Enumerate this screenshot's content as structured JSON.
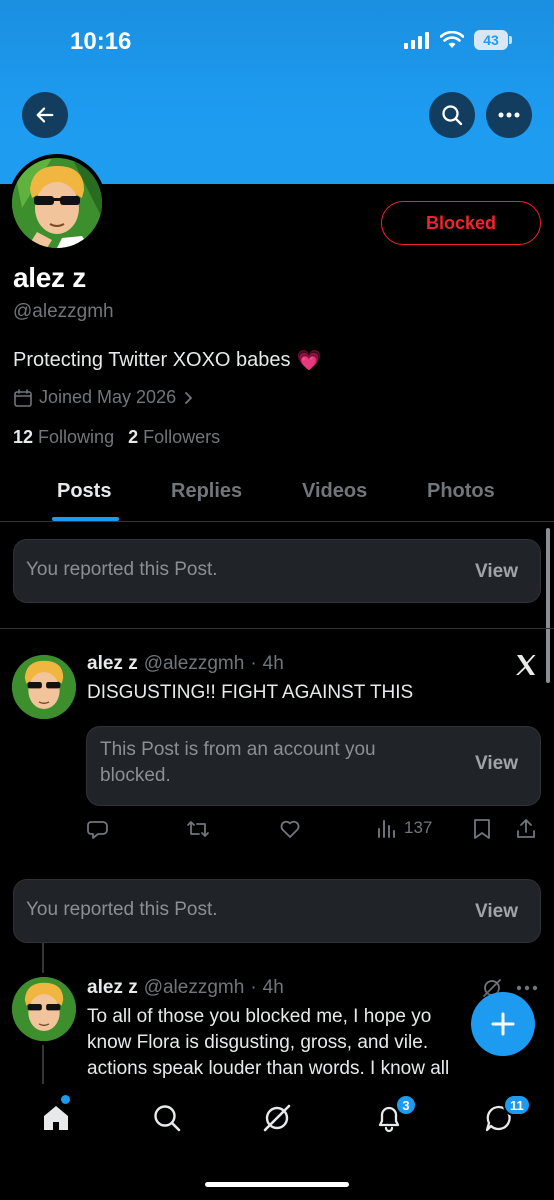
{
  "status_bar": {
    "time": "10:16",
    "battery": "43"
  },
  "header": {
    "back_icon": "arrow-left-icon",
    "search_icon": "search-icon",
    "more_icon": "more-horizontal-icon",
    "banner_color": "#1d9bf0"
  },
  "profile": {
    "name": "alez z",
    "handle": "@alezzgmh",
    "bio": "Protecting Twitter XOXO babes",
    "bio_emoji": "💗",
    "joined": "Joined May 2026",
    "following_count": "12",
    "following_label": "Following",
    "followers_count": "2",
    "followers_label": "Followers",
    "blocked_label": "Blocked",
    "blocked_color": "#f4212e"
  },
  "tabs": [
    {
      "label": "Posts",
      "active": true
    },
    {
      "label": "Replies",
      "active": false
    },
    {
      "label": "Videos",
      "active": false
    },
    {
      "label": "Photos",
      "active": false
    }
  ],
  "feed": {
    "report_notice_1": {
      "text": "You reported this Post.",
      "action": "View"
    },
    "post_1": {
      "name": "alez z",
      "handle": "@alezzgmh",
      "sep": "·",
      "time": "4h",
      "text": "DISGUSTING!! FIGHT AGAINST THIS",
      "quote_text": "This Post is from an account you blocked.",
      "quote_action": "View",
      "views": "137"
    },
    "report_notice_2": {
      "text": "You reported this Post.",
      "action": "View"
    },
    "post_2": {
      "name": "alez z",
      "handle": "@alezzgmh",
      "sep": "·",
      "time": "4h",
      "line1": "To all of those you blocked me, I hope yo",
      "line2": "know Flora is disgusting, gross, and vile.",
      "line3": "actions speak louder than words. I know all"
    }
  },
  "bottom_nav": {
    "notifications_badge": "3",
    "messages_badge": "11",
    "accent": "#1d9bf0"
  }
}
